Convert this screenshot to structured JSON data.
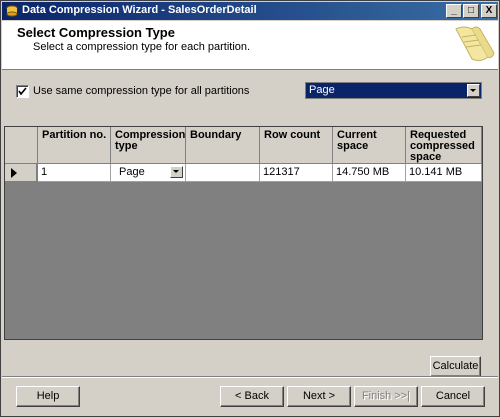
{
  "window": {
    "title": "Data Compression Wizard - SalesOrderDetail",
    "controls": {
      "minimize": "_",
      "restore": "□",
      "close": "X"
    }
  },
  "header": {
    "title": "Select Compression Type",
    "subtitle": "Select a compression type for each partition."
  },
  "options": {
    "same_type_label": "Use same compression type for all partitions",
    "same_type_checked": true,
    "compression_combo_value": "Page"
  },
  "grid": {
    "columns": [
      "Partition no.",
      "Compression type",
      "Boundary",
      "Row count",
      "Current space",
      "Requested compressed space"
    ],
    "rows": [
      {
        "partition": "1",
        "compression": "Page",
        "boundary": "",
        "row_count": "121317",
        "current_space": "14.750 MB",
        "requested_space": "10.141 MB"
      }
    ]
  },
  "buttons": {
    "calculate": "Calculate",
    "help": "Help",
    "back": "< Back",
    "next": "Next >",
    "finish": "Finish >>|",
    "cancel": "Cancel"
  }
}
